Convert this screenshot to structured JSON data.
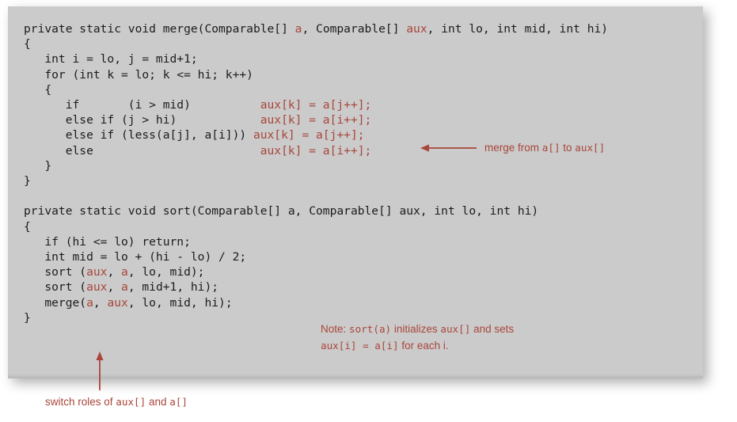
{
  "slide": {
    "background_color": "#ffffff",
    "panel_color": "#cbcbcb",
    "accent_color": "#a8463a",
    "code_color": "#1c1c1c"
  },
  "code": {
    "merge": {
      "line1_a": "private static void merge(Comparable[] ",
      "line1_hl1": "a",
      "line1_b": ", Comparable[] ",
      "line1_hl2": "aux",
      "line1_c": ", int lo, int mid, int hi)",
      "line2": "{",
      "line3": "   int i = lo, j = mid+1;",
      "line4": "   for (int k = lo; k <= hi; k++)",
      "line5": "   {",
      "line6_cond": "      if       (i > mid)          ",
      "line6_stmt": "aux[k] = a[j++];",
      "line7_cond": "      else if (j > hi)            ",
      "line7_stmt": "aux[k] = a[i++];",
      "line8_cond": "      else if (less(a[j], a[i])) ",
      "line8_stmt": "aux[k] = a[j++];",
      "line9_cond": "      else                        ",
      "line9_stmt": "aux[k] = a[i++];",
      "line10": "   }",
      "line11": "}"
    },
    "sort": {
      "line1": "private static void sort(Comparable[] a, Comparable[] aux, int lo, int hi)",
      "line2": "{",
      "line3": "   if (hi <= lo) return;",
      "line4": "   int mid = lo + (hi - lo) / 2;",
      "line5_a": "   sort (",
      "line5_hl1": "aux",
      "line5_b": ", ",
      "line5_hl2": "a",
      "line5_c": ", lo, mid);",
      "line6_a": "   sort (",
      "line6_hl1": "aux",
      "line6_b": ", ",
      "line6_hl2": "a",
      "line6_c": ", mid+1, hi);",
      "line7_a": "   merge(",
      "line7_hl1": "a",
      "line7_b": ", ",
      "line7_hl2": "aux",
      "line7_c": ", lo, mid, hi);",
      "line8": "}"
    }
  },
  "annotations": {
    "merge_direction": {
      "text_before": "merge from ",
      "mono1": "a[]",
      "text_middle": " to ",
      "mono2": "aux[]"
    },
    "note": {
      "line1_before": "Note: ",
      "line1_mono": "sort(a)",
      "line1_after": " initializes ",
      "line1_mono2": "aux[]",
      "line1_end": " and sets",
      "line2_mono": "aux[i] = a[i]",
      "line2_after": " for each i."
    },
    "switch_roles": {
      "text_before": "switch roles of ",
      "mono1": "aux[]",
      "text_middle": " and ",
      "mono2": "a[]"
    }
  },
  "icons": {
    "left_arrow": "left-arrow-icon",
    "up_arrow": "up-arrow-icon"
  }
}
